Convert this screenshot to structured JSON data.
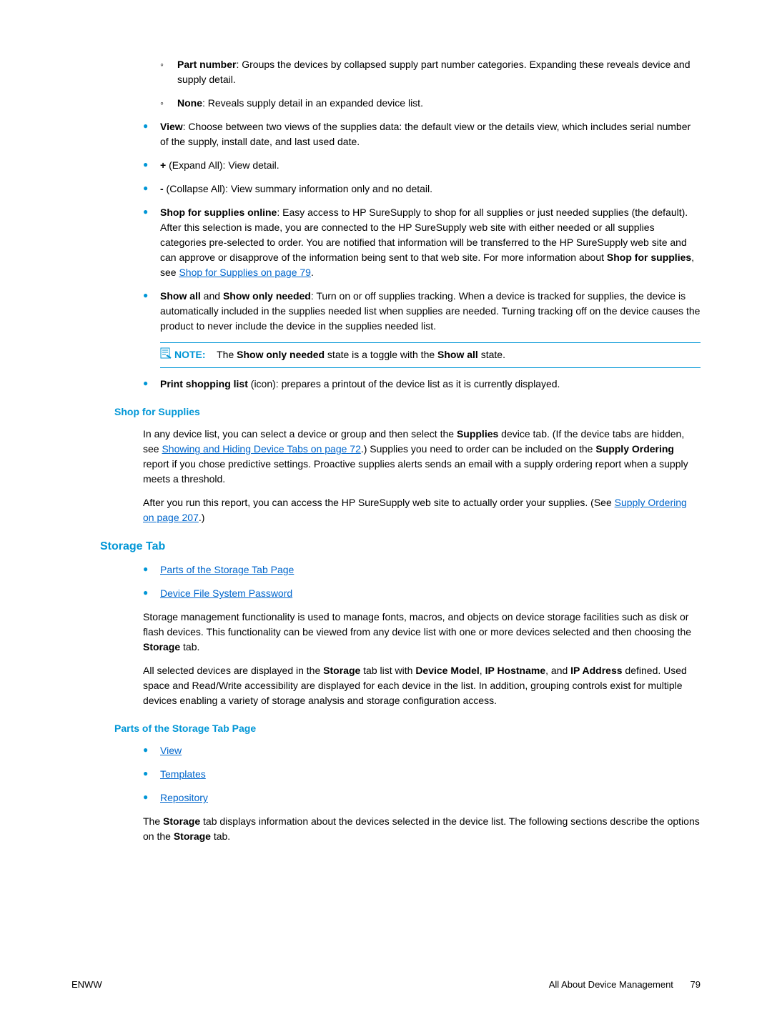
{
  "subBullets1": [
    {
      "bold": "Part number",
      "text": ": Groups the devices by collapsed supply part number categories. Expanding these reveals device and supply detail."
    },
    {
      "bold": "None",
      "text": ": Reveals supply detail in an expanded device list."
    }
  ],
  "bullets1": [
    {
      "bold": "View",
      "text": ": Choose between two views of the supplies data: the default view or the details view, which includes serial number of the supply, install date, and last used date."
    },
    {
      "bold": "+",
      "text": " (Expand All): View detail."
    },
    {
      "bold": "-",
      "text": " (Collapse All): View summary information only and no detail."
    },
    {
      "bold": "Shop for supplies online",
      "text": ": Easy access to HP SureSupply to shop for all supplies or just needed supplies (the default). After this selection is made, you are connected to the HP SureSupply web site with either needed or all supplies categories pre-selected to order. You are notified that information will be transferred to the HP SureSupply web site and can approve or disapprove of the information being sent to that web site. For more information about ",
      "bold2": "Shop for supplies",
      "text2": ", see ",
      "link": "Shop for Supplies on page 79",
      "text3": "."
    },
    {
      "bold": "Show all",
      "text": " and ",
      "bold2": "Show only needed",
      "text2": ": Turn on or off supplies tracking. When a device is tracked for supplies, the device is automatically included in the supplies needed list when supplies are needed. Turning tracking off on the device causes the product to never include the device in the supplies needed list."
    }
  ],
  "note": {
    "label": "NOTE:",
    "pre": "The ",
    "bold1": "Show only needed",
    "mid": " state is a toggle with the ",
    "bold2": "Show all",
    "post": " state."
  },
  "bullets2": [
    {
      "bold": "Print shopping list",
      "text": " (icon): prepares a printout of the device list as it is currently displayed."
    }
  ],
  "shopForSupplies": {
    "heading": "Shop for Supplies",
    "para1_pre": "In any device list, you can select a device or group and then select the ",
    "para1_bold1": "Supplies",
    "para1_mid1": " device tab. (If the device tabs are hidden, see ",
    "para1_link": "Showing and Hiding Device Tabs on page 72",
    "para1_mid2": ".) Supplies you need to order can be included on the ",
    "para1_bold2": "Supply Ordering",
    "para1_post": " report if you chose predictive settings. Proactive supplies alerts sends an email with a supply ordering report when a supply meets a threshold.",
    "para2_pre": "After you run this report, you can access the HP SureSupply web site to actually order your supplies. (See ",
    "para2_link": "Supply Ordering on page 207",
    "para2_post": ".)"
  },
  "storageTab": {
    "heading": "Storage Tab",
    "links": [
      "Parts of the Storage Tab Page",
      "Device File System Password"
    ],
    "para1_pre": "Storage management functionality is used to manage fonts, macros, and objects on device storage facilities such as disk or flash devices. This functionality can be viewed from any device list with one or more devices selected and then choosing the ",
    "para1_bold": "Storage",
    "para1_post": " tab.",
    "para2_pre": "All selected devices are displayed in the ",
    "para2_bold1": "Storage",
    "para2_mid1": " tab list with ",
    "para2_bold2": "Device Model",
    "para2_mid2": ", ",
    "para2_bold3": "IP Hostname",
    "para2_mid3": ", and ",
    "para2_bold4": "IP Address",
    "para2_post": " defined. Used space and Read/Write accessibility are displayed for each device in the list. In addition, grouping controls exist for multiple devices enabling a variety of storage analysis and storage configuration access."
  },
  "partsStorage": {
    "heading": "Parts of the Storage Tab Page",
    "links": [
      "View",
      "Templates",
      "Repository"
    ],
    "para_pre": "The ",
    "para_bold1": "Storage",
    "para_mid": " tab displays information about the devices selected in the device list. The following sections describe the options on the ",
    "para_bold2": "Storage",
    "para_post": " tab."
  },
  "footer": {
    "left": "ENWW",
    "rightText": "All About Device Management",
    "pageNum": "79"
  }
}
